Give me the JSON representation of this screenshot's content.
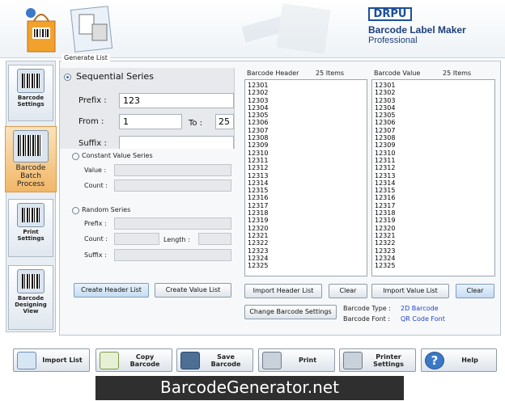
{
  "brand": {
    "company": "DRPU",
    "title": "Barcode Label Maker",
    "subtitle": "Professional"
  },
  "nav": [
    {
      "label": "Barcode Settings"
    },
    {
      "label": "Barcode Batch Process"
    },
    {
      "label": "Print Settings"
    },
    {
      "label": "Barcode Designing View"
    }
  ],
  "group_title": "Generate List",
  "sequential": {
    "label": "Sequential Series",
    "prefix_label": "Prefix :",
    "prefix_value": "123",
    "from_label": "From :",
    "from_value": "1",
    "to_label": "To :",
    "to_value": "25",
    "suffix_label": "Suffix :"
  },
  "constant": {
    "label": "Constant Value Series",
    "value_label": "Value :",
    "count_label": "Count :"
  },
  "random": {
    "label": "Random Series",
    "prefix_label": "Prefix :",
    "count_label": "Count :",
    "length_label": "Length :",
    "suffix_label": "Suffix :"
  },
  "header_list": {
    "title": "Barcode Header",
    "count": "25 Items",
    "items": [
      "12301",
      "12302",
      "12303",
      "12304",
      "12305",
      "12306",
      "12307",
      "12308",
      "12309",
      "12310",
      "12311",
      "12312",
      "12313",
      "12314",
      "12315",
      "12316",
      "12317",
      "12318",
      "12319",
      "12320",
      "12321",
      "12322",
      "12323",
      "12324",
      "12325"
    ]
  },
  "value_list": {
    "title": "Barcode Value",
    "count": "25 Items",
    "items": [
      "12301",
      "12302",
      "12303",
      "12304",
      "12305",
      "12306",
      "12307",
      "12308",
      "12309",
      "12310",
      "12311",
      "12312",
      "12313",
      "12314",
      "12315",
      "12316",
      "12317",
      "12318",
      "12319",
      "12320",
      "12321",
      "12322",
      "12323",
      "12324",
      "12325"
    ]
  },
  "buttons": {
    "create_header": "Create Header List",
    "create_value": "Create Value List",
    "import_header": "Import Header List",
    "clear_header": "Clear",
    "import_value": "Import Value List",
    "clear_value": "Clear",
    "change_settings": "Change Barcode Settings"
  },
  "info": {
    "type_label": "Barcode Type :",
    "type_value": "2D Barcode",
    "font_label": "Barcode Font :",
    "font_value": "QR Code Font"
  },
  "toolbar": [
    {
      "label": "Import List",
      "icon": "import-list-icon"
    },
    {
      "label": "Copy Barcode",
      "icon": "copy-barcode-icon"
    },
    {
      "label": "Save Barcode",
      "icon": "floppy-disk-icon"
    },
    {
      "label": "Print",
      "icon": "printer-icon"
    },
    {
      "label": "Printer Settings",
      "icon": "printer-settings-icon"
    },
    {
      "label": "Help",
      "icon": "help-icon"
    }
  ],
  "footer": "BarcodeGenerator.net",
  "colors": {
    "accent": "#1d4f9a",
    "active_nav": "#f1b767",
    "link_blue": "#2244cc"
  }
}
